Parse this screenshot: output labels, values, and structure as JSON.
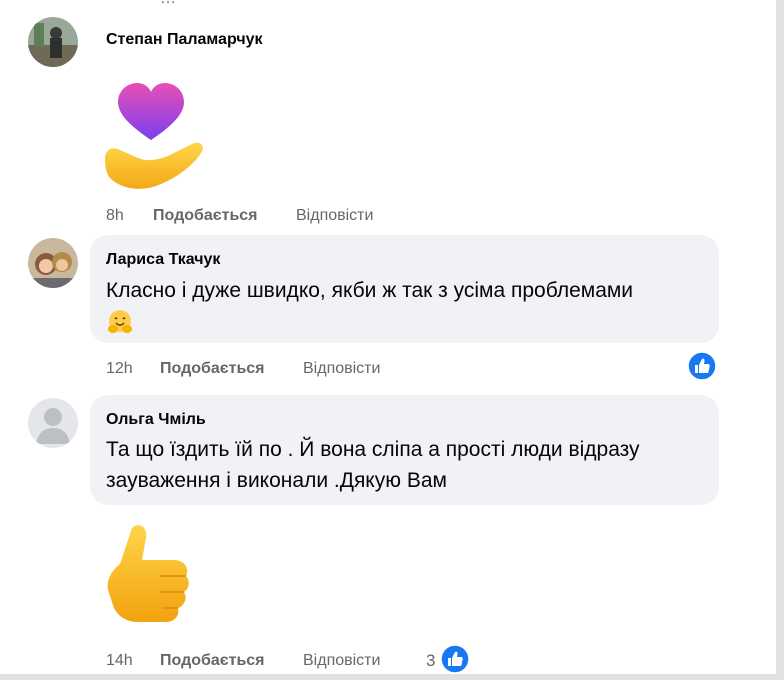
{
  "comments": [
    {
      "author": "Степан Паламарчук",
      "time": "8h",
      "like_label": "Подобається",
      "reply_label": "Відповісти",
      "sticker": "heart-hand-sticker"
    },
    {
      "author": "Лариса Ткачук",
      "text": "Класно і дуже швидко, якби ж так з усіма проблемами",
      "time": "12h",
      "like_label": "Подобається",
      "reply_label": "Відповісти",
      "reaction": "like-icon"
    },
    {
      "author": "Ольга Чміль",
      "text_line1": "Та що їздить їй по . Й вона сліпа а прості люди відразу",
      "text_line2": "зауваження і виконали .Дякую Вам",
      "time": "14h",
      "like_label": "Подобається",
      "reply_label": "Відповісти",
      "reaction_count": "3",
      "sticker": "thumbs-up-sticker",
      "reaction": "like-icon"
    }
  ],
  "colors": {
    "bubble": "#f0f2f5",
    "meta": "#65676b",
    "like_blue": "#1877f2"
  }
}
